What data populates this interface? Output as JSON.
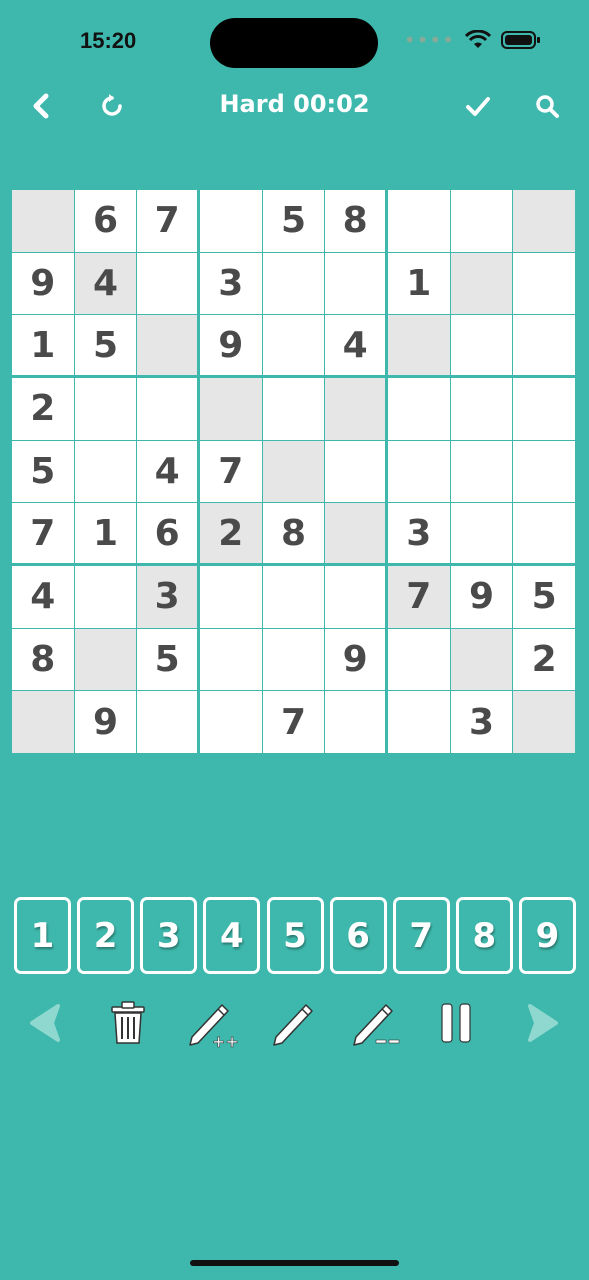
{
  "status": {
    "time": "15:20",
    "dots": "••••"
  },
  "header": {
    "title": "Hard 00:02"
  },
  "board": {
    "cells": [
      [
        "",
        "6",
        "7",
        "",
        "5",
        "8",
        "",
        "",
        ""
      ],
      [
        "9",
        "4",
        "",
        "3",
        "",
        "",
        "1",
        "",
        ""
      ],
      [
        "1",
        "5",
        "",
        "9",
        "",
        "4",
        "",
        "",
        ""
      ],
      [
        "2",
        "",
        "",
        "",
        "",
        "",
        "",
        "",
        ""
      ],
      [
        "5",
        "",
        "4",
        "7",
        "",
        "",
        "",
        "",
        ""
      ],
      [
        "7",
        "1",
        "6",
        "2",
        "8",
        "",
        "3",
        "",
        ""
      ],
      [
        "4",
        "",
        "3",
        "",
        "",
        "",
        "7",
        "9",
        "5"
      ],
      [
        "8",
        "",
        "5",
        "",
        "",
        "9",
        "",
        "",
        "2"
      ],
      [
        "",
        "9",
        "",
        "",
        "7",
        "",
        "",
        "3",
        ""
      ]
    ],
    "shaded": [
      [
        0,
        0
      ],
      [
        0,
        8
      ],
      [
        1,
        1
      ],
      [
        1,
        7
      ],
      [
        2,
        2
      ],
      [
        2,
        6
      ],
      [
        3,
        3
      ],
      [
        3,
        5
      ],
      [
        4,
        4
      ],
      [
        5,
        3
      ],
      [
        5,
        5
      ],
      [
        6,
        2
      ],
      [
        6,
        6
      ],
      [
        7,
        1
      ],
      [
        7,
        7
      ],
      [
        8,
        0
      ],
      [
        8,
        8
      ]
    ]
  },
  "numpad": [
    "1",
    "2",
    "3",
    "4",
    "5",
    "6",
    "7",
    "8",
    "9"
  ],
  "tools": {
    "icons": [
      "back-arrow-icon",
      "trash-icon",
      "pencil-add-icon",
      "pencil-icon",
      "pencil-clear-icon",
      "pause-icon",
      "forward-arrow-icon"
    ]
  },
  "colors": {
    "background": "#3eb8ac",
    "cell": "#ffffff",
    "shade": "#e6e6e6",
    "digit": "#4a4a4a"
  }
}
